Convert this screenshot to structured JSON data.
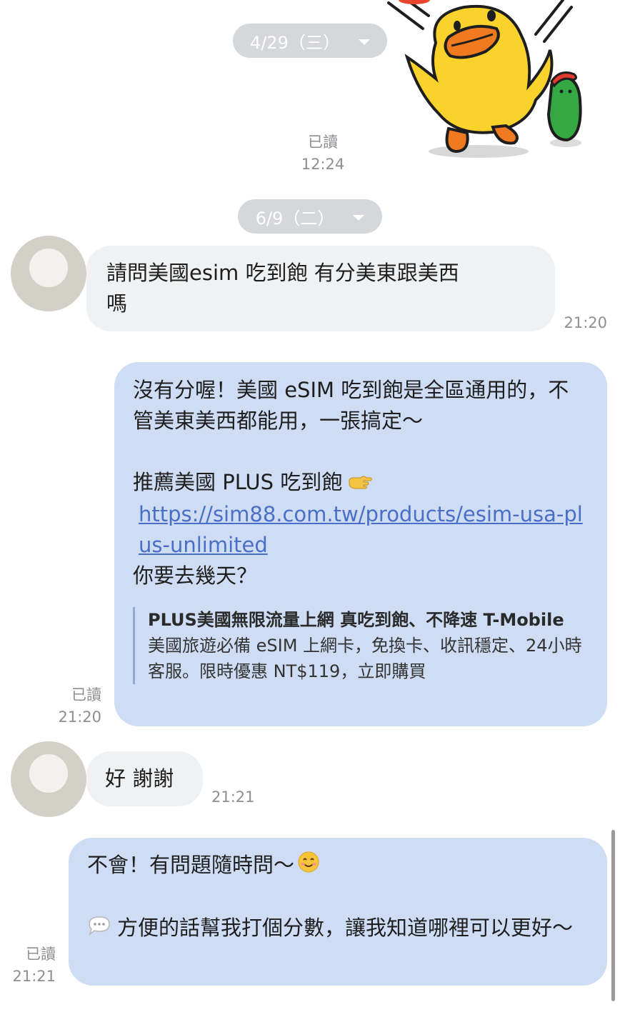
{
  "dates": [
    {
      "label": "4/29（三）"
    },
    {
      "label": "6/9（二）"
    }
  ],
  "messages": [
    {
      "type": "sticker",
      "direction": "out",
      "sticker": "duck-sticker",
      "read": "已讀",
      "time": "12:24"
    },
    {
      "type": "text",
      "direction": "in",
      "text": "請問美國esim 吃到飽 有分美東跟美西\n嗎",
      "time": "21:20"
    },
    {
      "type": "text",
      "direction": "out",
      "text1": "沒有分喔！美國 eSIM 吃到飽是全區通用的，不管美東美西都能用，一張搞定～",
      "text2": "推薦美國 PLUS 吃到飽",
      "link": "https://sim88.com.tw/products/esim-usa-plus-unlimited",
      "text3": "你要去幾天？",
      "preview": {
        "title": "PLUS美國無限流量上網 真吃到飽、不降速 T-Mobile",
        "description": "美國旅遊必備 eSIM 上網卡，免換卡、收訊穩定、24小時客服。限時優惠 NT$119，立即購買"
      },
      "read": "已讀",
      "time": "21:20"
    },
    {
      "type": "text",
      "direction": "in",
      "text": "好 謝謝",
      "time": "21:21"
    },
    {
      "type": "text",
      "direction": "out",
      "text1": "不會！有問題隨時問～",
      "text2": "方便的話幫我打個分數，讓我知道哪裡可以更好～",
      "read": "已讀",
      "time": "21:21"
    }
  ],
  "icons": {
    "caret": "chevron-down-icon",
    "point": "pointing-hand-icon",
    "smile": "smiling-face-icon",
    "speech": "speech-balloon-icon"
  },
  "colors": {
    "outgoing_bubble": "#cedcf4",
    "incoming_bubble": "#f0f1f3",
    "link": "#4a6fc7",
    "date_pill": "#d6d7da"
  }
}
